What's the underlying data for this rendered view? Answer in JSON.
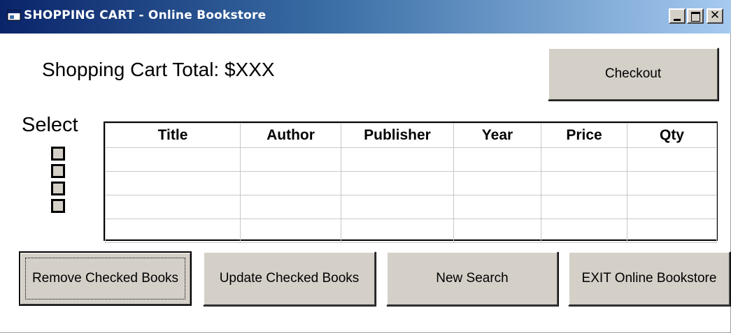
{
  "window": {
    "title": "SHOPPING CART - Online Bookstore",
    "caption_buttons": {
      "minimize": "minimize",
      "maximize": "maximize",
      "close": "✕"
    }
  },
  "cart": {
    "total_label": "Shopping Cart Total: $XXX",
    "checkout_label": "Checkout",
    "select_label": "Select",
    "checkbox_count": 4
  },
  "grid": {
    "columns": [
      "Title",
      "Author",
      "Publisher",
      "Year",
      "Price",
      "Qty"
    ],
    "rows": [
      [
        "",
        "",
        "",
        "",
        "",
        ""
      ],
      [
        "",
        "",
        "",
        "",
        "",
        ""
      ],
      [
        "",
        "",
        "",
        "",
        "",
        ""
      ],
      [
        "",
        "",
        "",
        "",
        "",
        ""
      ]
    ]
  },
  "actions": {
    "remove_label": "Remove Checked Books",
    "update_label": "Update Checked Books",
    "new_search_label": "New Search",
    "exit_label": "EXIT Online Bookstore"
  },
  "colors": {
    "titlebar_start": "#0a246a",
    "titlebar_end": "#a6caf0",
    "button_face": "#d4d0c8"
  }
}
